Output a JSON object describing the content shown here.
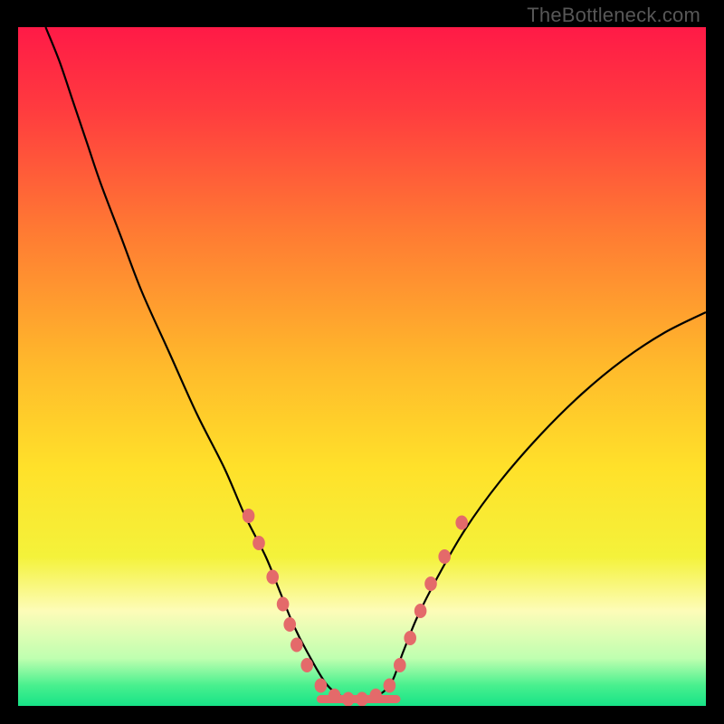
{
  "watermark": "TheBottleneck.com",
  "chart_data": {
    "type": "line",
    "title": "",
    "xlabel": "",
    "ylabel": "",
    "xlim": [
      0,
      100
    ],
    "ylim": [
      0,
      100
    ],
    "background_gradient": {
      "type": "vertical",
      "stops": [
        {
          "pos": 0.0,
          "color": "#ff1a47"
        },
        {
          "pos": 0.12,
          "color": "#ff3b3f"
        },
        {
          "pos": 0.3,
          "color": "#ff7a33"
        },
        {
          "pos": 0.5,
          "color": "#ffba2b"
        },
        {
          "pos": 0.65,
          "color": "#ffe12a"
        },
        {
          "pos": 0.78,
          "color": "#f4f23a"
        },
        {
          "pos": 0.86,
          "color": "#fdfcb8"
        },
        {
          "pos": 0.93,
          "color": "#bfffb0"
        },
        {
          "pos": 0.97,
          "color": "#48f08e"
        },
        {
          "pos": 1.0,
          "color": "#17e387"
        }
      ]
    },
    "series": [
      {
        "name": "bottleneck-curve",
        "color": "#000000",
        "x": [
          4,
          6,
          8,
          10,
          12,
          15,
          18,
          22,
          26,
          30,
          33,
          36,
          38,
          40,
          42,
          45,
          48,
          51,
          54,
          56,
          58,
          61,
          65,
          70,
          76,
          82,
          88,
          94,
          100
        ],
        "y": [
          100,
          95,
          89,
          83,
          77,
          69,
          61,
          52,
          43,
          35,
          28,
          22,
          17,
          12,
          8,
          3,
          1,
          1,
          3,
          8,
          13,
          19,
          26,
          33,
          40,
          46,
          51,
          55,
          58
        ]
      }
    ],
    "markers": {
      "name": "highlight-dots",
      "color": "#e46a6a",
      "radius": 8,
      "points": [
        {
          "x": 33.5,
          "y": 28
        },
        {
          "x": 35.0,
          "y": 24
        },
        {
          "x": 37.0,
          "y": 19
        },
        {
          "x": 38.5,
          "y": 15
        },
        {
          "x": 39.5,
          "y": 12
        },
        {
          "x": 40.5,
          "y": 9
        },
        {
          "x": 42.0,
          "y": 6
        },
        {
          "x": 44.0,
          "y": 3
        },
        {
          "x": 46.0,
          "y": 1.5
        },
        {
          "x": 48.0,
          "y": 1
        },
        {
          "x": 50.0,
          "y": 1
        },
        {
          "x": 52.0,
          "y": 1.5
        },
        {
          "x": 54.0,
          "y": 3
        },
        {
          "x": 55.5,
          "y": 6
        },
        {
          "x": 57.0,
          "y": 10
        },
        {
          "x": 58.5,
          "y": 14
        },
        {
          "x": 60.0,
          "y": 18
        },
        {
          "x": 62.0,
          "y": 22
        },
        {
          "x": 64.5,
          "y": 27
        }
      ]
    },
    "flat_segment": {
      "name": "baseline-run",
      "color": "#e46a6a",
      "width": 9,
      "x0": 44,
      "x1": 55,
      "y": 1
    }
  }
}
